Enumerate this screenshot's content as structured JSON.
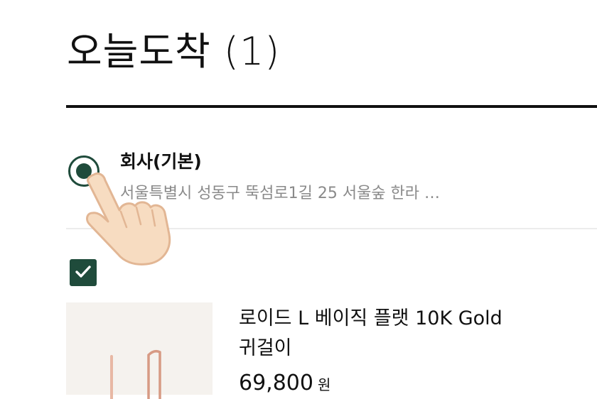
{
  "header": {
    "title": "오늘도착 (1)"
  },
  "address": {
    "name": "회사(기본)",
    "detail": "서울특별시 성동구 뚝섬로1길 25 서울숲 한라 …",
    "selected": true
  },
  "product": {
    "checked": true,
    "name": "로이드 L 베이직 플랫 10K Gold 귀걸이",
    "price": "69,800",
    "price_unit": "원"
  },
  "colors": {
    "accent": "#1f4b3b",
    "text": "#111111",
    "muted": "#8a8a8a"
  },
  "icons": {
    "checkbox": "check-icon",
    "pointer": "hand-pointer-icon"
  }
}
